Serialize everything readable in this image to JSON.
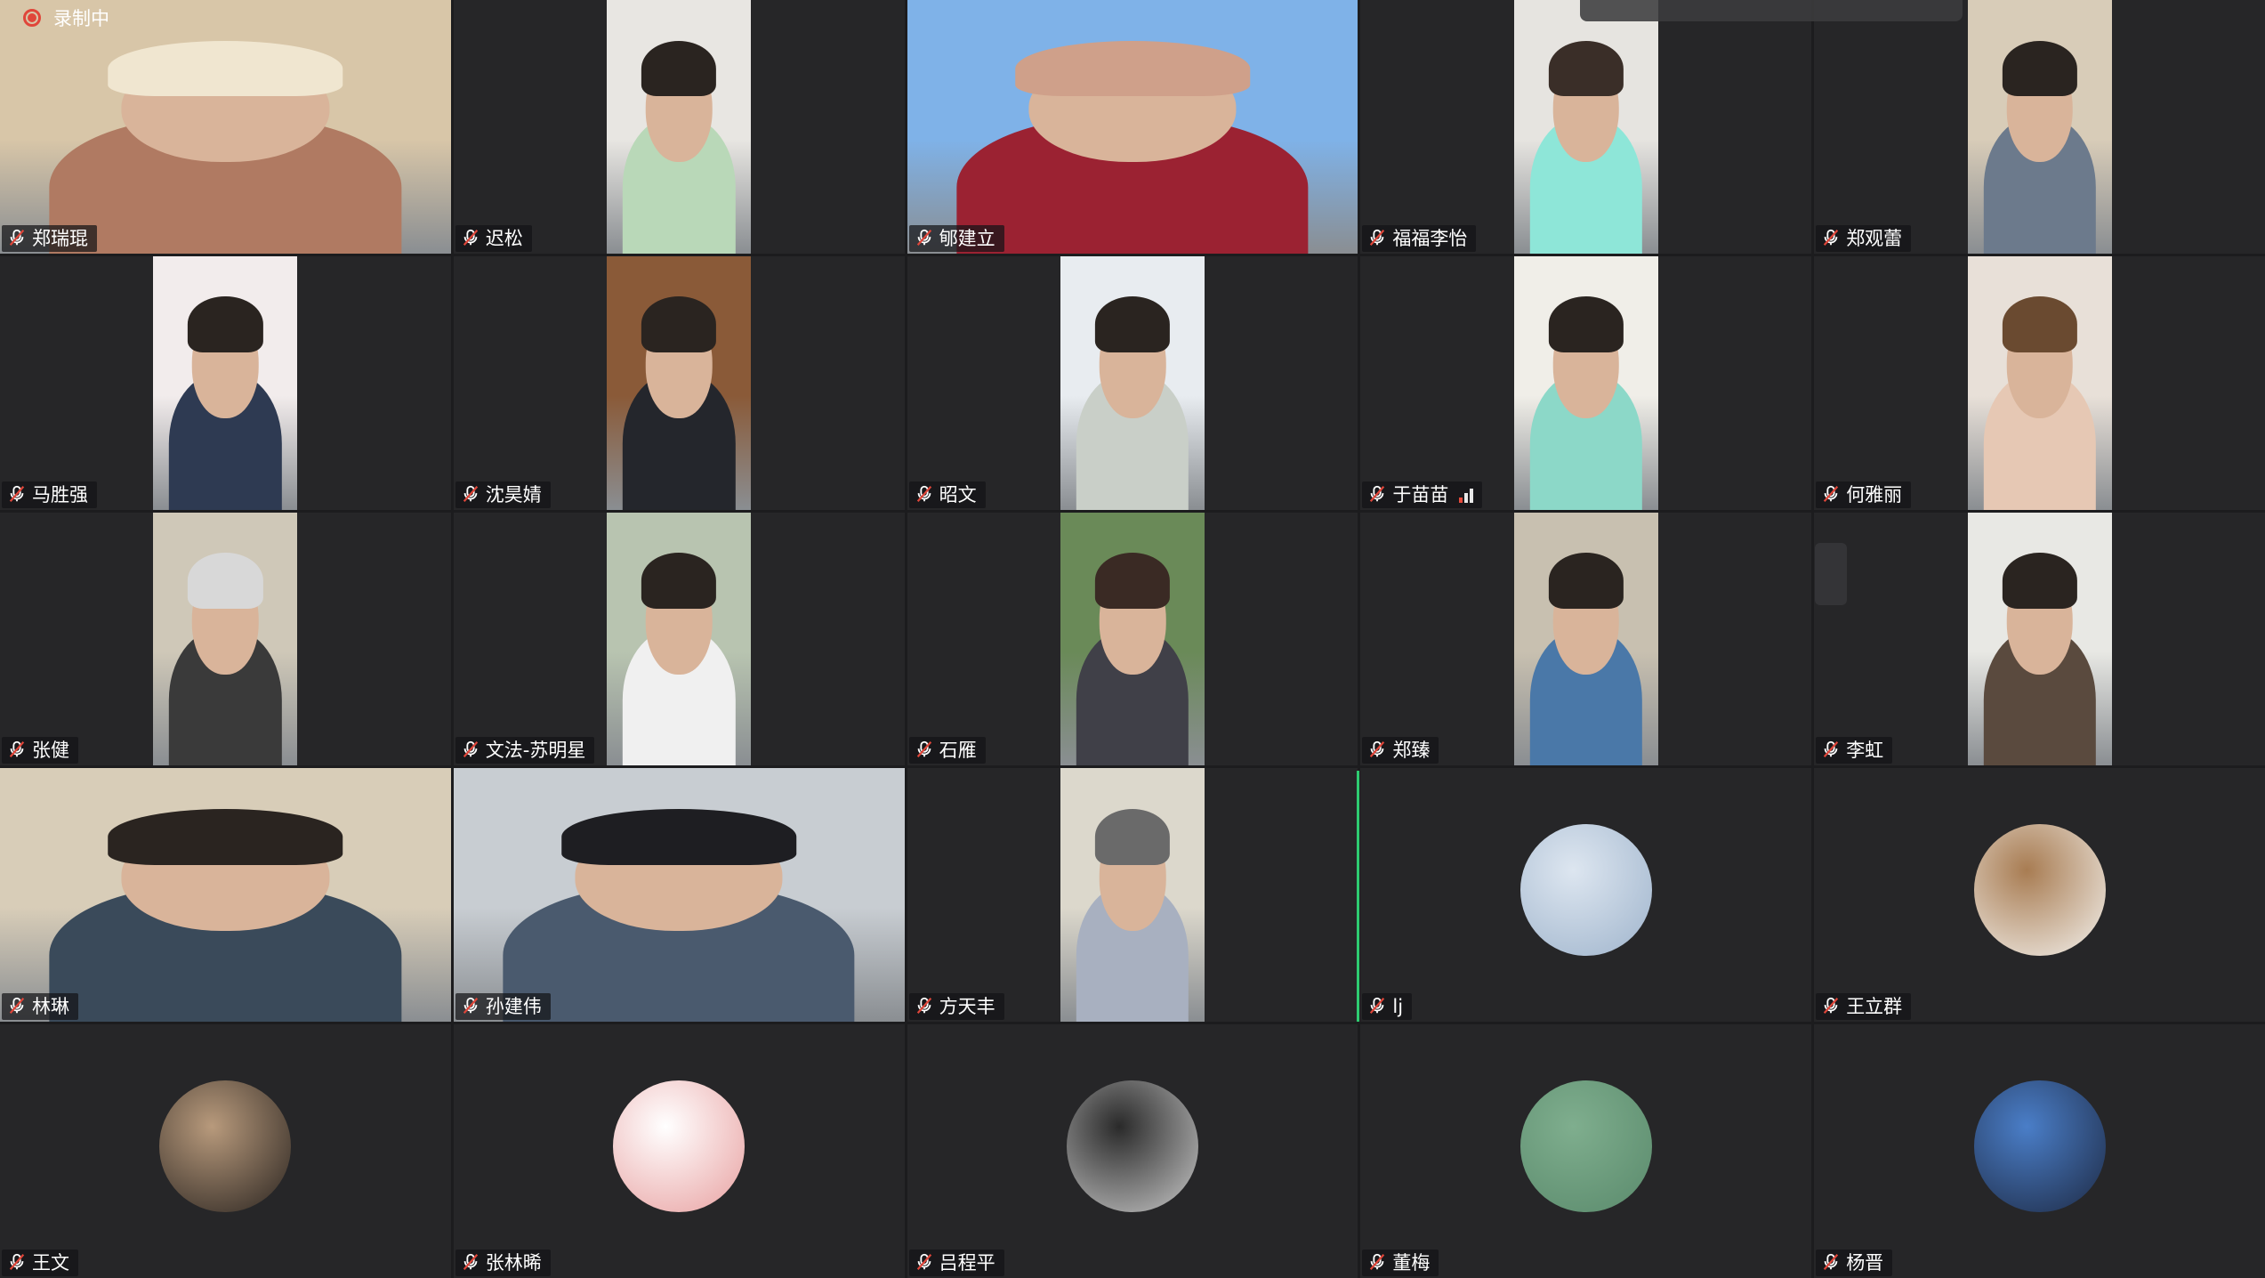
{
  "recording": {
    "label": "录制中",
    "color": "#e0463a"
  },
  "participants": [
    {
      "name": "郑瑞琨",
      "kind": "video-full",
      "colors": [
        "#d8c6a8",
        "#b07a62",
        "#f0e6d0"
      ]
    },
    {
      "name": "迟松",
      "kind": "video-mid",
      "colors": [
        "#e8e6e2",
        "#b9d8b8",
        "#2a2420"
      ]
    },
    {
      "name": "郇建立",
      "kind": "video-full",
      "colors": [
        "#7fb2e8",
        "#9b2232",
        "#cfa08a"
      ]
    },
    {
      "name": "福福李怡",
      "kind": "video-mid",
      "colors": [
        "#e6e4e0",
        "#8ee6d8",
        "#3a2e28"
      ]
    },
    {
      "name": "郑观蕾",
      "kind": "video-mid",
      "colors": [
        "#d8ccb8",
        "#6c7a8c",
        "#2a2420"
      ]
    },
    {
      "name": "马胜强",
      "kind": "video-mid",
      "colors": [
        "#f2ecec",
        "#2e3a52",
        "#2a2420"
      ]
    },
    {
      "name": "沈昊婧",
      "kind": "video-mid",
      "colors": [
        "#8a5a38",
        "#24262c",
        "#2a2420"
      ]
    },
    {
      "name": "昭文",
      "kind": "video-mid",
      "colors": [
        "#e8ecf0",
        "#c9cfc8",
        "#2a2420"
      ]
    },
    {
      "name": "于苗苗",
      "kind": "video-mid",
      "colors": [
        "#f0eee8",
        "#8cd8c8",
        "#2a2420"
      ],
      "signal": true
    },
    {
      "name": "何雅丽",
      "kind": "video-mid",
      "colors": [
        "#e8e0d8",
        "#e6c8b4",
        "#6a4a30"
      ]
    },
    {
      "name": "张健",
      "kind": "video-mid",
      "colors": [
        "#cfc8b8",
        "#3a3a3a",
        "#d8d8d8"
      ]
    },
    {
      "name": "文法-苏明星",
      "kind": "video-mid",
      "colors": [
        "#b8c4b0",
        "#f0f0f0",
        "#2a2420"
      ]
    },
    {
      "name": "石雁",
      "kind": "video-mid",
      "colors": [
        "#6a8a58",
        "#404048",
        "#3a2a24"
      ]
    },
    {
      "name": "郑臻",
      "kind": "video-mid",
      "colors": [
        "#c8c0b0",
        "#4a78a8",
        "#2a2420"
      ]
    },
    {
      "name": "李虹",
      "kind": "video-mid",
      "colors": [
        "#e8e8e4",
        "#5a4a3e",
        "#2a2420"
      ]
    },
    {
      "name": "林琳",
      "kind": "video-full",
      "colors": [
        "#d8cdb8",
        "#3a4a5a",
        "#2a2420"
      ]
    },
    {
      "name": "孙建伟",
      "kind": "video-full",
      "colors": [
        "#c8cdd2",
        "#4a5a6e",
        "#1e1e22"
      ]
    },
    {
      "name": "方天丰",
      "kind": "video-mid",
      "colors": [
        "#dcd8cc",
        "#a8b0c0",
        "#6a6a6a"
      ]
    },
    {
      "name": "lj",
      "kind": "avatar",
      "avatar": "snowflake-avatar",
      "colors": [
        "#dde6f0",
        "#9fb4cc"
      ]
    },
    {
      "name": "王立群",
      "kind": "avatar",
      "avatar": "kitten-avatar",
      "colors": [
        "#a87c52",
        "#f4f2ee"
      ]
    },
    {
      "name": "王文",
      "kind": "avatar",
      "avatar": "portrait-avatar",
      "colors": [
        "#b89a7c",
        "#2a2420"
      ]
    },
    {
      "name": "张林晞",
      "kind": "avatar",
      "avatar": "cartoon-avatar",
      "colors": [
        "#ffffff",
        "#e8a0a0"
      ]
    },
    {
      "name": "吕程平",
      "kind": "avatar",
      "avatar": "dark-window-avatar",
      "colors": [
        "#2a2a2a",
        "#c8c8c8"
      ]
    },
    {
      "name": "董梅",
      "kind": "avatar",
      "avatar": "green-water-avatar",
      "colors": [
        "#7fae8e",
        "#5a8a6c"
      ]
    },
    {
      "name": "杨晋",
      "kind": "avatar",
      "avatar": "blue-sky-person-avatar",
      "colors": [
        "#4a7ec8",
        "#1e2a44"
      ]
    }
  ]
}
